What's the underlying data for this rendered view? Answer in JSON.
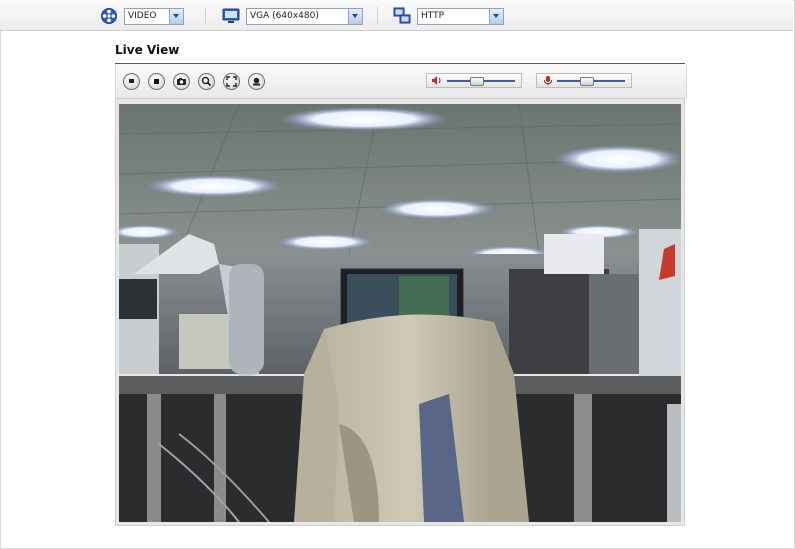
{
  "toolbar": {
    "stream_type": {
      "value": "VIDEO",
      "icon": "film-reel-icon"
    },
    "resolution": {
      "value": "VGA (640x480)",
      "icon": "monitor-icon"
    },
    "protocol": {
      "value": "HTTP",
      "icon": "network-computer-icon"
    }
  },
  "live_view": {
    "title": "Live View",
    "buttons": [
      {
        "name": "pause-button",
        "icon": "pause-icon"
      },
      {
        "name": "stop-button",
        "icon": "stop-icon"
      },
      {
        "name": "snapshot-button",
        "icon": "camera-icon"
      },
      {
        "name": "digital-zoom-button",
        "icon": "magnifier-icon"
      },
      {
        "name": "fullscreen-button",
        "icon": "fullscreen-icon"
      },
      {
        "name": "record-button",
        "icon": "record-icon"
      }
    ],
    "speaker_volume_level": 0.45,
    "mic_volume_level": 0.45,
    "speaker_icon": "speaker-icon",
    "mic_icon": "microphone-icon"
  },
  "colors": {
    "accent": "#26487f",
    "toolbar_bg": "#ececec"
  }
}
